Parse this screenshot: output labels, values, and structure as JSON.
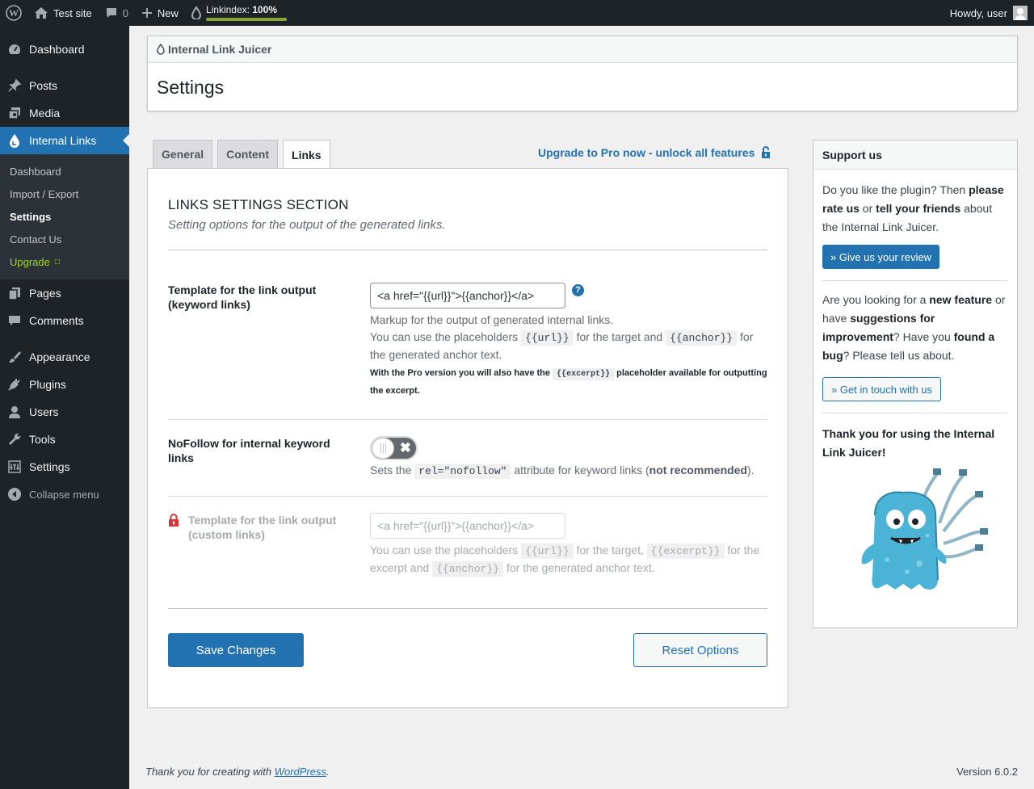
{
  "adminbar": {
    "site_name": "Test site",
    "comments_count": "0",
    "new_label": "New",
    "linkindex_label": "Linkindex:",
    "linkindex_value": "100%",
    "linkindex_progress": 1.0,
    "howdy": "Howdy, user"
  },
  "sidebar": {
    "items": [
      {
        "label": "Dashboard",
        "icon": "dashboard-icon"
      },
      {
        "label": "Posts",
        "icon": "pin-icon"
      },
      {
        "label": "Media",
        "icon": "media-icon"
      },
      {
        "label": "Internal Links",
        "icon": "drop-icon"
      },
      {
        "label": "Pages",
        "icon": "pages-icon"
      },
      {
        "label": "Comments",
        "icon": "comment-icon"
      },
      {
        "label": "Appearance",
        "icon": "brush-icon"
      },
      {
        "label": "Plugins",
        "icon": "plug-icon"
      },
      {
        "label": "Users",
        "icon": "user-icon"
      },
      {
        "label": "Tools",
        "icon": "wrench-icon"
      },
      {
        "label": "Settings",
        "icon": "settings-icon"
      }
    ],
    "submenu": [
      "Dashboard",
      "Import / Export",
      "Settings",
      "Contact Us",
      "Upgrade"
    ],
    "collapse": "Collapse menu"
  },
  "header": {
    "plugin_name": "Internal Link Juicer",
    "page_title": "Settings"
  },
  "tabs": [
    "General",
    "Content",
    "Links"
  ],
  "upgrade_link": "Upgrade to Pro now - unlock all features",
  "section": {
    "title": "LINKS SETTINGS SECTION",
    "description": "Setting options for the output of the generated links."
  },
  "fields": {
    "template": {
      "label": "Template for the link output (keyword links)",
      "value": "<a href=\"{{url}}\">{{anchor}}</a>",
      "help": "?",
      "desc1": "Markup for the output of generated internal links.",
      "desc2a": "You can use the placeholders",
      "code_url": "{{url}}",
      "desc2b": "for the target and",
      "code_anchor": "{{anchor}}",
      "desc2c": "for the generated anchor text.",
      "pro_a": "With the Pro version you will also have the",
      "code_excerpt": "{{excerpt}}",
      "pro_b": "placeholder available for outputting the excerpt."
    },
    "nofollow": {
      "label": "NoFollow for internal keyword links",
      "desc_a": "Sets the",
      "code": "rel=\"nofollow\"",
      "desc_b": "attribute for keyword links (",
      "desc_bold": "not recommended",
      "desc_c": ")."
    },
    "custom": {
      "label": "Template for the link output (custom links)",
      "placeholder": "<a href=\"{{url}}\">{{anchor}}</a>",
      "desc_a": "You can use the placeholders",
      "code_url": "{{url}}",
      "desc_b": "for the target,",
      "code_excerpt": "{{excerpt}}",
      "desc_c": "for the excerpt and",
      "code_anchor": "{{anchor}}",
      "desc_d": "for the generated anchor text."
    }
  },
  "buttons": {
    "save": "Save Changes",
    "reset": "Reset Options"
  },
  "support": {
    "title": "Support us",
    "p1_a": "Do you like the plugin? Then ",
    "p1_b": "please rate us",
    "p1_c": " or ",
    "p1_d": "tell your friends",
    "p1_e": " about the Internal Link Juicer.",
    "review_btn": "» Give us your review",
    "p2_a": "Are you looking for a ",
    "p2_b": "new feature",
    "p2_c": " or have ",
    "p2_d": "suggestions for improvement",
    "p2_e": "? Have you ",
    "p2_f": "found a bug",
    "p2_g": "? Please tell us about.",
    "contact_btn": "» Get in touch with us",
    "thanks": "Thank you for using the Internal Link Juicer!"
  },
  "footer": {
    "thanks_a": "Thank you for creating with",
    "wp_link": "WordPress",
    "thanks_b": ".",
    "version": "Version 6.0.2"
  }
}
